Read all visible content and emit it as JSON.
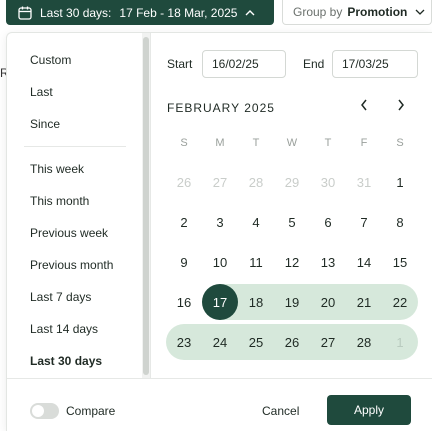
{
  "trigger": {
    "prefix": "Last 30 days:",
    "range": "17 Feb - 18 Mar, 2025",
    "icon": "calendar-icon"
  },
  "group_by": {
    "label": "Group by",
    "value": "Promotion"
  },
  "background_peek": "R",
  "presets": [
    {
      "label": "Custom",
      "active": false
    },
    {
      "label": "Last",
      "active": false
    },
    {
      "label": "Since",
      "active": false
    },
    {
      "label": "This week",
      "active": false
    },
    {
      "label": "This month",
      "active": false
    },
    {
      "label": "Previous week",
      "active": false
    },
    {
      "label": "Previous month",
      "active": false
    },
    {
      "label": "Last 7 days",
      "active": false
    },
    {
      "label": "Last 14 days",
      "active": false
    },
    {
      "label": "Last 30 days",
      "active": true
    }
  ],
  "start": {
    "label": "Start",
    "value": "16/02/25"
  },
  "end": {
    "label": "End",
    "value": "17/03/25"
  },
  "calendar": {
    "month_title": "FEBRUARY 2025",
    "weekdays": [
      "S",
      "M",
      "T",
      "W",
      "T",
      "F",
      "S"
    ],
    "weeks": [
      [
        "26",
        "27",
        "28",
        "29",
        "30",
        "31",
        "1"
      ],
      [
        "2",
        "3",
        "4",
        "5",
        "6",
        "7",
        "8"
      ],
      [
        "9",
        "10",
        "11",
        "12",
        "13",
        "14",
        "15"
      ],
      [
        "16",
        "17",
        "18",
        "19",
        "20",
        "21",
        "22"
      ],
      [
        "23",
        "24",
        "25",
        "26",
        "27",
        "28",
        "1"
      ]
    ],
    "selected_day": "17"
  },
  "compare": {
    "label": "Compare",
    "enabled": false
  },
  "actions": {
    "cancel": "Cancel",
    "apply": "Apply"
  },
  "colors": {
    "accent": "#1f4a3d",
    "range": "#d6e8db"
  }
}
